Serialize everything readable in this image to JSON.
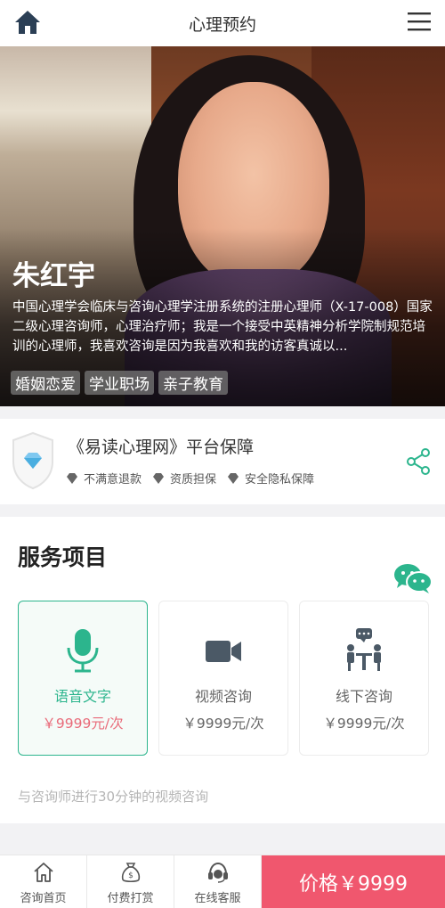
{
  "header": {
    "title": "心理预约",
    "home_icon": "home-icon",
    "menu_icon": "hamburger-menu-icon"
  },
  "counselor": {
    "name": "朱红宇",
    "bio": "中国心理学会临床与咨询心理学注册系统的注册心理师（X-17-008）国家二级心理咨询师，心理治疗师；我是一个接受中英精神分析学院制规范培训的心理师，我喜欢咨询是因为我喜欢和我的访客真诚以...",
    "tags": [
      "婚姻恋爱",
      "学业职场",
      "亲子教育"
    ]
  },
  "guarantee": {
    "title": "《易读心理网》平台保障",
    "items": [
      "不满意退款",
      "资质担保",
      "安全隐私保障"
    ],
    "accent": "#2cb58d"
  },
  "services": {
    "title": "服务项目",
    "options": [
      {
        "name": "语音文字",
        "price": "￥9999元/次",
        "icon": "microphone-icon",
        "selected": true
      },
      {
        "name": "视频咨询",
        "price": "￥9999元/次",
        "icon": "video-camera-icon",
        "selected": false
      },
      {
        "name": "线下咨询",
        "price": "￥9999元/次",
        "icon": "face-to-face-icon",
        "selected": false
      }
    ],
    "description": "与咨询师进行30分钟的视频咨询"
  },
  "bottom_bar": {
    "tabs": [
      {
        "label": "咨询首页",
        "icon": "home-outline-icon"
      },
      {
        "label": "付费打赏",
        "icon": "money-bag-icon"
      },
      {
        "label": "在线客服",
        "icon": "headset-icon"
      }
    ],
    "price_button": "价格￥9999",
    "price_color": "#f0576e"
  }
}
